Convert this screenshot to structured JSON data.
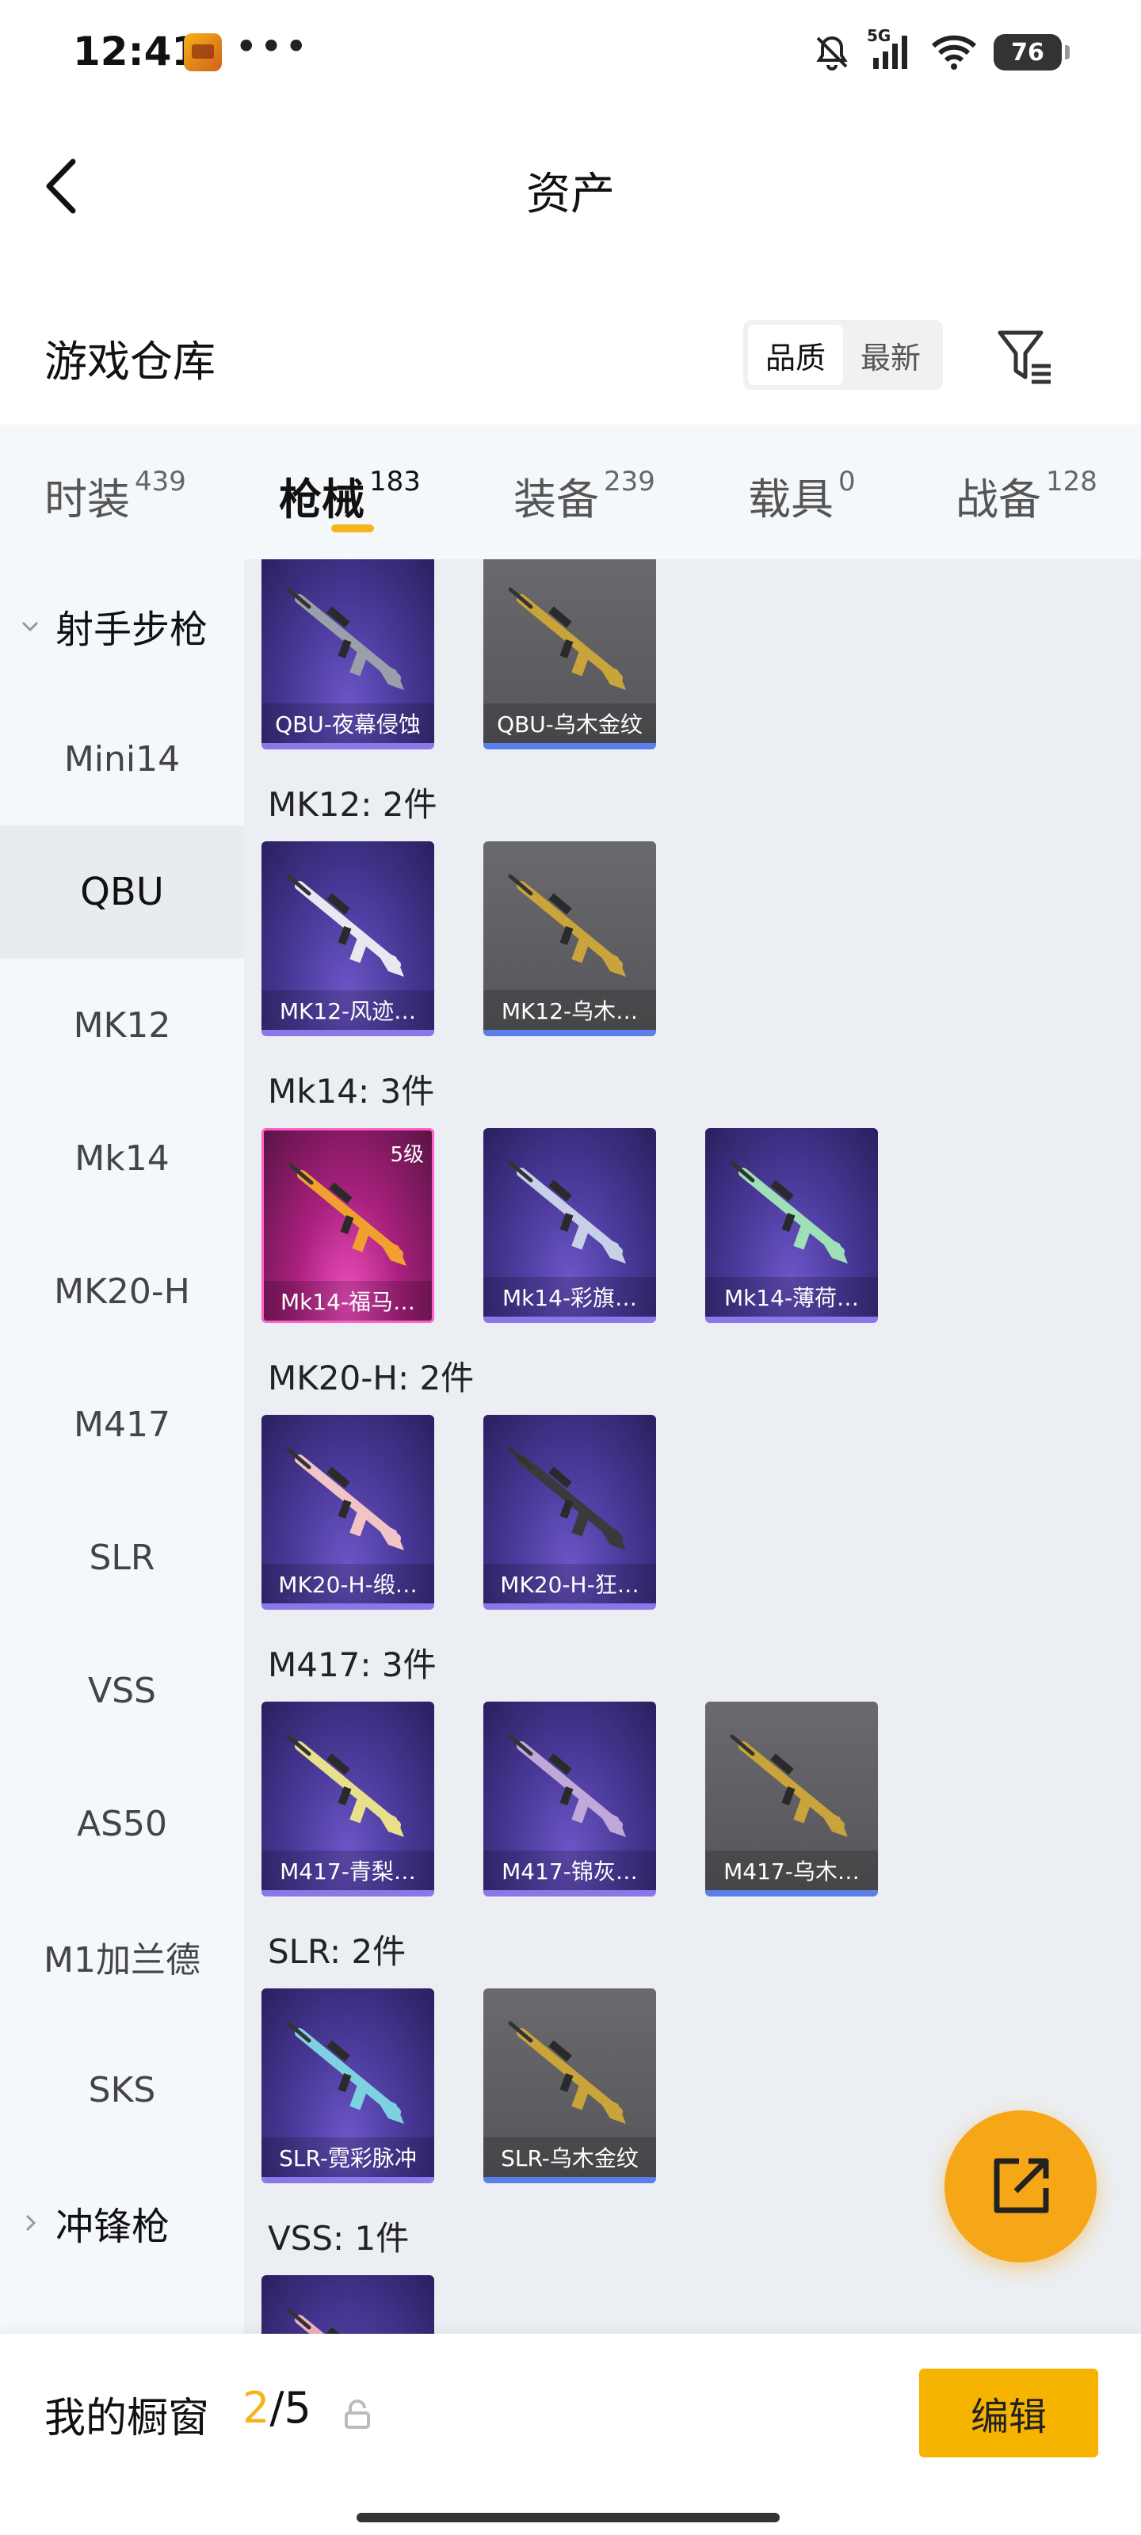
{
  "status_bar": {
    "time": "12:41",
    "network": "5G",
    "battery": "76",
    "more": "•••"
  },
  "header": {
    "title": "资产",
    "back_icon": "chevron-left-icon"
  },
  "warehouse": {
    "title": "游戏仓库",
    "sort_options": [
      "品质",
      "最新"
    ],
    "active_sort": "品质",
    "filter_icon": "filter-icon"
  },
  "tabs": [
    {
      "label": "时装",
      "count": "439"
    },
    {
      "label": "枪械",
      "count": "183",
      "active": true
    },
    {
      "label": "装备",
      "count": "239"
    },
    {
      "label": "载具",
      "count": "0"
    },
    {
      "label": "战备",
      "count": "128"
    }
  ],
  "sidebar": {
    "group_expanded": "射手步枪",
    "items": [
      "Mini14",
      "QBU",
      "MK12",
      "Mk14",
      "MK20-H",
      "M417",
      "SLR",
      "VSS",
      "AS50",
      "M1加兰德",
      "SKS"
    ],
    "active_item": "QBU",
    "group_collapsed": "冲锋枪"
  },
  "sections": [
    {
      "label": "",
      "cards": [
        {
          "name": "QBU-夜幕侵蚀",
          "style": "purple",
          "gun_color": "#9aa0aa"
        },
        {
          "name": "QBU-乌木金纹",
          "style": "gray",
          "gun_color": "#c9a43a"
        }
      ]
    },
    {
      "label": "MK12: 2件",
      "cards": [
        {
          "name": "MK12-风迹…",
          "style": "purple",
          "gun_color": "#e8e8f0"
        },
        {
          "name": "MK12-乌木…",
          "style": "gray",
          "gun_color": "#c9a43a"
        }
      ]
    },
    {
      "label": "Mk14: 3件",
      "cards": [
        {
          "name": "Mk14-福马…",
          "style": "pink",
          "gun_color": "#f0a030",
          "level": "5级"
        },
        {
          "name": "Mk14-彩旗…",
          "style": "purple",
          "gun_color": "#c8d0e8"
        },
        {
          "name": "Mk14-薄荷…",
          "style": "purple",
          "gun_color": "#9fe0b8"
        }
      ]
    },
    {
      "label": "MK20-H: 2件",
      "cards": [
        {
          "name": "MK20-H-缎…",
          "style": "purple",
          "gun_color": "#f2c4c8"
        },
        {
          "name": "MK20-H-狂…",
          "style": "purple",
          "gun_color": "#3a3a3a"
        }
      ]
    },
    {
      "label": "M417: 3件",
      "cards": [
        {
          "name": "M417-青梨…",
          "style": "purple",
          "gun_color": "#e8e08a"
        },
        {
          "name": "M417-锦灰…",
          "style": "purple",
          "gun_color": "#c0a8d8"
        },
        {
          "name": "M417-乌木…",
          "style": "gray",
          "gun_color": "#c9a43a"
        }
      ]
    },
    {
      "label": "SLR: 2件",
      "cards": [
        {
          "name": "SLR-霓彩脉冲",
          "style": "purple",
          "gun_color": "#7fd0e0"
        },
        {
          "name": "SLR-乌木金纹",
          "style": "gray",
          "gun_color": "#c9a43a"
        }
      ]
    },
    {
      "label": "VSS: 1件",
      "cards": [
        {
          "name": "",
          "style": "purple",
          "gun_color": "#f0b0c0"
        }
      ]
    }
  ],
  "showcase": {
    "label": "我的橱窗",
    "current": "2",
    "total": "/5",
    "edit_label": "编辑"
  },
  "colors": {
    "accent": "#f4b51c",
    "purple_card": "#4a3a9a",
    "gray_card": "#5e5e62",
    "pink_card": "#a8207d"
  }
}
